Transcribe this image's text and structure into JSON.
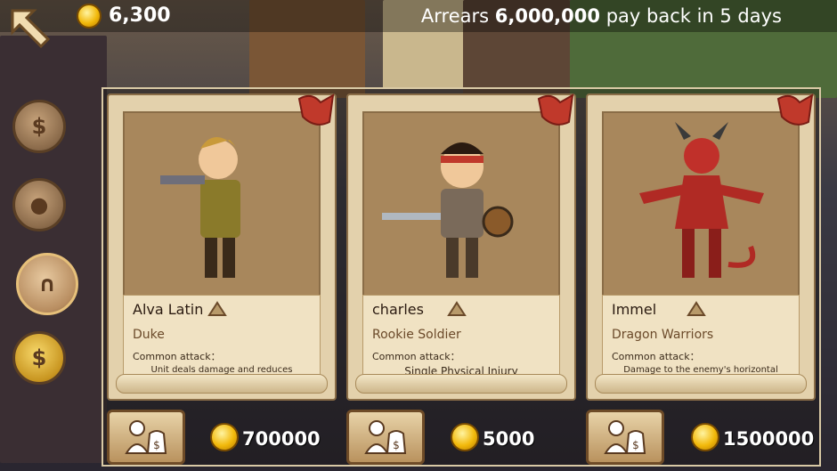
{
  "header": {
    "gold": "6,300",
    "arrears_prefix": "Arrears",
    "arrears_amount": "6,000,000",
    "arrears_suffix": "pay back in 5 days"
  },
  "side_menu": [
    {
      "icon": "money-bag-icon"
    },
    {
      "icon": "stone-icon"
    },
    {
      "icon": "horseshoe-icon",
      "active": true
    },
    {
      "icon": "gold-money-bag-icon"
    }
  ],
  "heroes": [
    {
      "name": "Alva Latin",
      "class": "Duke",
      "attack_label": "Common attack：",
      "attack_desc": "Unit deals damage and reduces",
      "price": "700000"
    },
    {
      "name": "charles",
      "class": "Rookie Soldier",
      "attack_label": "Common attack：",
      "attack_desc": "Single Physical Injury",
      "price": "5000"
    },
    {
      "name": "Immel",
      "class": "Dragon Warriors",
      "attack_label": "Common attack：",
      "attack_desc": "Damage to the enemy's horizontal",
      "price": "1500000"
    }
  ],
  "colors": {
    "card_bg": "#e3d1ac",
    "portrait_bg": "#a8875c",
    "ribbon": "#c0392b",
    "coin": "#f2b90b"
  }
}
